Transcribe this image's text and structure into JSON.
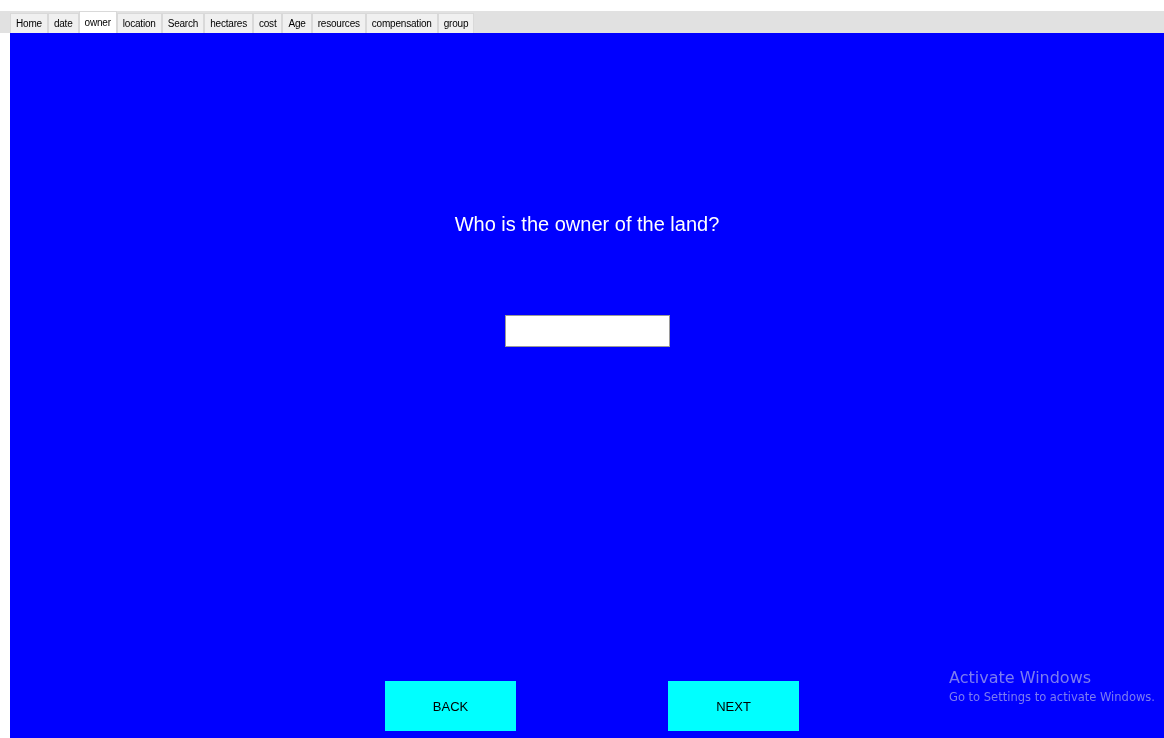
{
  "tabs": [
    {
      "label": "Home",
      "selected": false
    },
    {
      "label": "date",
      "selected": false
    },
    {
      "label": "owner",
      "selected": true
    },
    {
      "label": "location",
      "selected": false
    },
    {
      "label": "Search",
      "selected": false
    },
    {
      "label": "hectares",
      "selected": false
    },
    {
      "label": "cost",
      "selected": false
    },
    {
      "label": "Age",
      "selected": false
    },
    {
      "label": "resources",
      "selected": false
    },
    {
      "label": "compensation",
      "selected": false
    },
    {
      "label": "group",
      "selected": false
    }
  ],
  "question": "Who is the owner of the land?",
  "buttons": [
    "BACK",
    "NEXT"
  ],
  "activation_notice": {
    "title": "Activate Windows",
    "message": "Go to Settings to activate Windows."
  }
}
